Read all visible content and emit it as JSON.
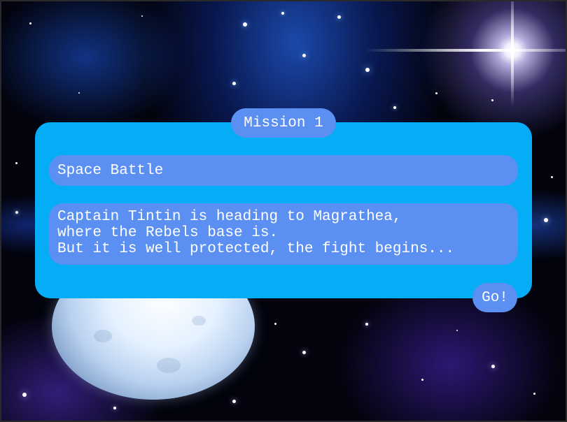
{
  "scene": {
    "background": "space-nebula-with-moon",
    "panel_color": "#04adf5",
    "pill_color": "#5b8ff2",
    "text_color": "#ffffff"
  },
  "mission": {
    "tab_label": "Mission 1",
    "title": "Space Battle",
    "description_lines": [
      "Captain Tintin is heading to Magrathea,",
      "where the Rebels base is.",
      "But it is well protected, the fight begins..."
    ],
    "go_label": "Go!"
  }
}
